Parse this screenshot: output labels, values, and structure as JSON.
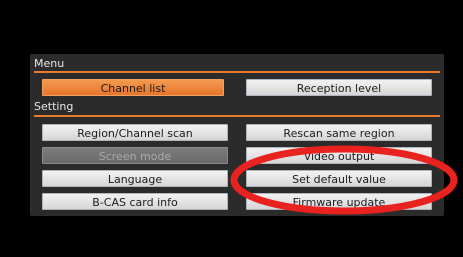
{
  "menu": {
    "header": "Menu",
    "items": [
      {
        "label": "Channel list",
        "state": "selected"
      },
      {
        "label": "Reception level",
        "state": "normal"
      }
    ]
  },
  "setting": {
    "header": "Setting",
    "items": [
      {
        "label": "Region/Channel scan",
        "state": "normal"
      },
      {
        "label": "Rescan same region",
        "state": "normal"
      },
      {
        "label": "Screen mode",
        "state": "disabled"
      },
      {
        "label": "Video output",
        "state": "normal"
      },
      {
        "label": "Language",
        "state": "normal"
      },
      {
        "label": "Set default value",
        "state": "normal"
      },
      {
        "label": "B-CAS card info",
        "state": "normal"
      },
      {
        "label": "Firmware update",
        "state": "normal"
      }
    ]
  },
  "colors": {
    "accent": "#e97a2b",
    "annotation_ring": "#e8221f"
  }
}
